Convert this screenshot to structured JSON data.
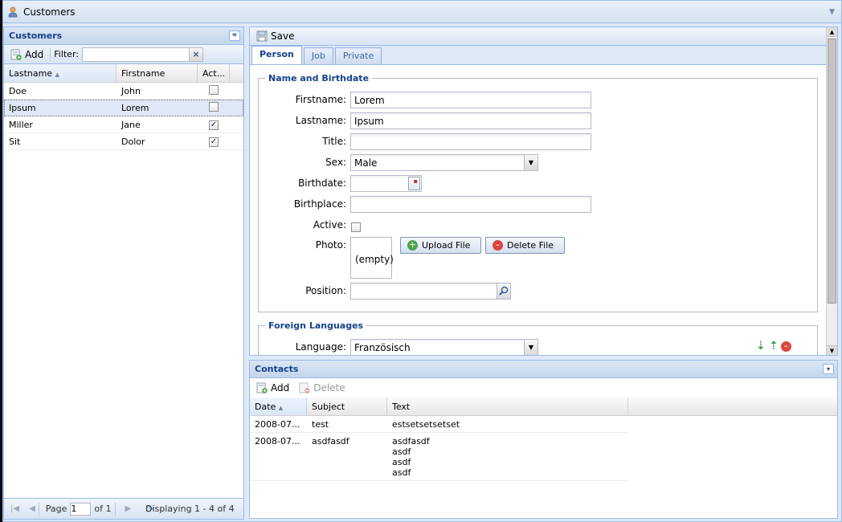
{
  "window": {
    "title": "Customers"
  },
  "customers": {
    "title": "Customers",
    "add_label": "Add",
    "filter_label": "Filter:",
    "filter_value": "",
    "columns": [
      "Lastname",
      "Firstname",
      "Act..."
    ],
    "rows": [
      {
        "lastname": "Doe",
        "firstname": "John",
        "active": false
      },
      {
        "lastname": "Ipsum",
        "firstname": "Lorem",
        "active": false
      },
      {
        "lastname": "Miller",
        "firstname": "Jane",
        "active": true
      },
      {
        "lastname": "Sit",
        "firstname": "Dolor",
        "active": true
      }
    ],
    "selected_row": 1,
    "pager": {
      "page_label": "Page",
      "page_value": "1",
      "of_label": "of 1",
      "display_text": "Displaying 1 - 4 of 4"
    }
  },
  "editor": {
    "save_label": "Save",
    "tabs": [
      "Person",
      "Job",
      "Private"
    ],
    "active_tab": 0,
    "name_section": {
      "legend": "Name and Birthdate",
      "firstname_label": "Firstname:",
      "firstname_value": "Lorem",
      "lastname_label": "Lastname:",
      "lastname_value": "Ipsum",
      "title_label": "Title:",
      "title_value": "",
      "sex_label": "Sex:",
      "sex_value": "Male",
      "birthdate_label": "Birthdate:",
      "birthdate_value": "",
      "birthplace_label": "Birthplace:",
      "birthplace_value": "",
      "active_label": "Active:",
      "active_value": false,
      "photo_label": "Photo:",
      "photo_value": "(empty)",
      "upload_label": "Upload File",
      "delete_label": "Delete File",
      "position_label": "Position:",
      "position_value": ""
    },
    "languages_section": {
      "legend": "Foreign Languages",
      "language_label": "Language:",
      "language_value": "Französisch"
    }
  },
  "contacts": {
    "title": "Contacts",
    "add_label": "Add",
    "delete_label": "Delete",
    "columns": [
      "Date",
      "Subject",
      "Text"
    ],
    "rows": [
      {
        "date": "2008-07...",
        "subject": "test",
        "text": [
          "estsetsetsetset"
        ]
      },
      {
        "date": "2008-07...",
        "subject": "asdfasdf",
        "text": [
          "asdfasdf",
          "asdf",
          "asdf",
          "asdf"
        ]
      }
    ]
  },
  "colors": {
    "accent": "#15428b",
    "border": "#99bbe8",
    "selected": "#dfe8f6"
  },
  "icons": [
    "user-icon",
    "collapse-left-icon",
    "collapse-down-icon",
    "add-icon",
    "clear-icon",
    "save-icon",
    "calendar-icon",
    "search-icon",
    "upload-icon",
    "delete-icon",
    "move-down-icon",
    "move-up-icon",
    "remove-icon",
    "refresh-icon"
  ]
}
